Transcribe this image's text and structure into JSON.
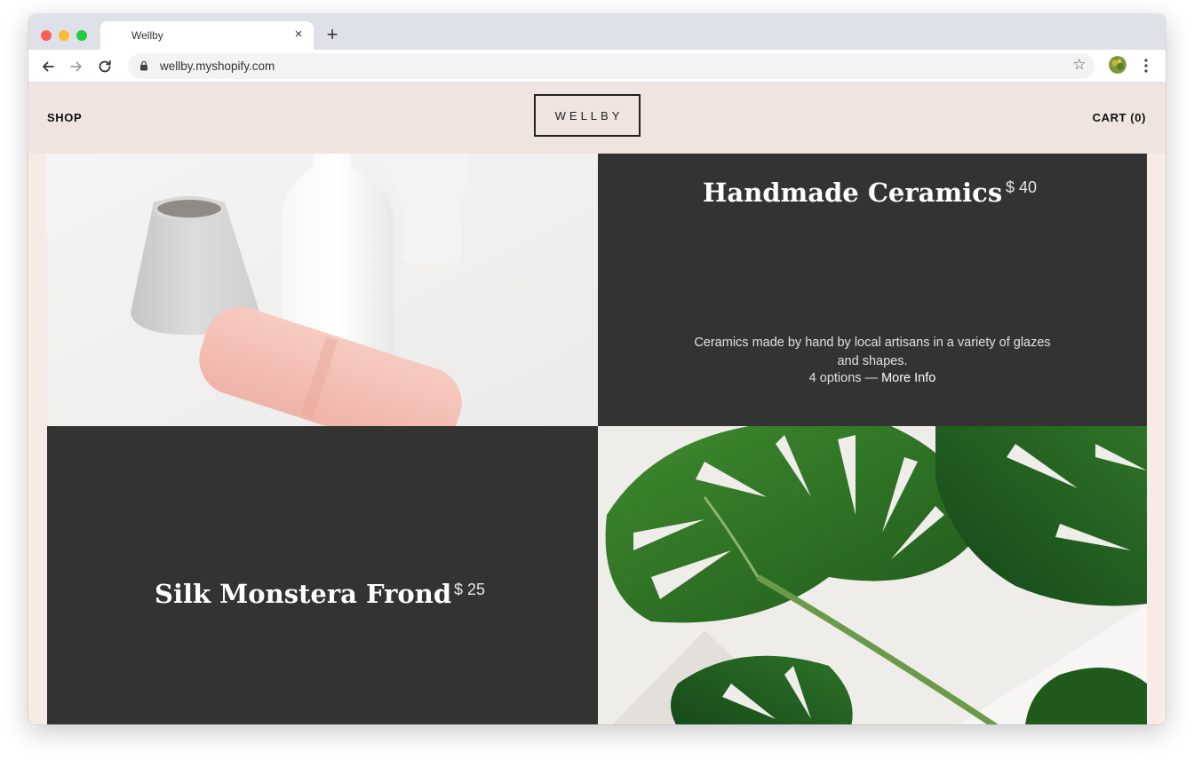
{
  "browser": {
    "tab_title": "Wellby",
    "tab_close": "×",
    "new_tab": "+",
    "url": "wellby.myshopify.com",
    "bookmark_icon": "☆",
    "colors": {
      "chrome": "#dfe1e8",
      "omnibox": "#f1f3f4"
    }
  },
  "header": {
    "shop_label": "SHOP",
    "logo_text": "WELLBY",
    "cart_label": "CART (0)"
  },
  "products": [
    {
      "title": "Handmade Ceramics",
      "price": "$ 40",
      "description": "Ceramics made by hand by local artisans in a variety of glazes and shapes.",
      "options_text": "4 options — ",
      "more_info": "More Info",
      "image_icon": "ceramic-vases-photo"
    },
    {
      "title": "Silk Monstera Frond",
      "price": "$ 25",
      "image_icon": "monstera-leaf-photo"
    }
  ],
  "colors": {
    "header_bg": "#efe4df",
    "panel_bg": "#333333",
    "page_bg": "#f6ece5"
  }
}
